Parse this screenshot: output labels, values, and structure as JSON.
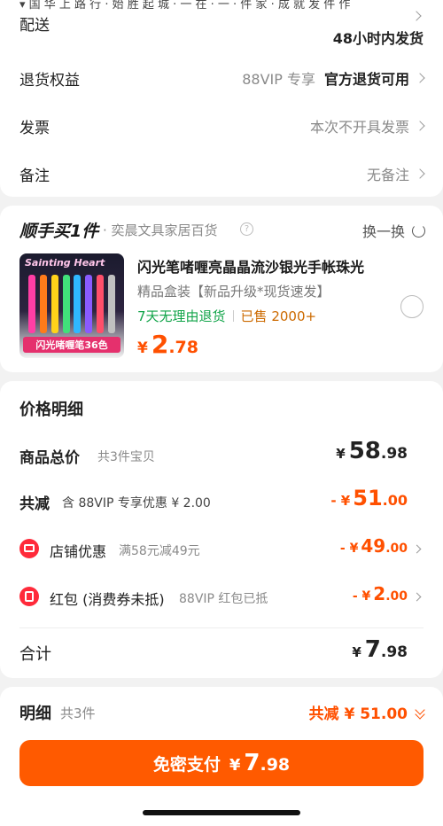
{
  "top_partial": "▾ 国 华 上 路 行 · 始 胜 起 城 · 一 在 · 一 · 件 家 · 成 就 发 件 作",
  "delivery": {
    "label": "配送",
    "value": "48小时内发货"
  },
  "refund": {
    "label": "退货权益",
    "badge": "88VIP 专享",
    "value": "官方退货可用"
  },
  "invoice": {
    "label": "发票",
    "value": "本次不开具发票"
  },
  "note": {
    "label": "备注",
    "value": "无备注"
  },
  "addon": {
    "logo": "顺手买1件",
    "store": "· 奕晨文具家居百货",
    "help_icon": "question-circle-icon",
    "swap": "换一换",
    "product": {
      "image_text_top": "Sainting Heart",
      "image_text_bottom": "闪光啫喱笔36色",
      "title": "闪光笔啫喱亮晶晶流沙银光手帐珠光",
      "subtitle": "精品盒装【新品升级*现货速发】",
      "return": "7天无理由退货",
      "sold": "已售 2000+",
      "price_int": "2",
      "price_dec": ".78",
      "currency": "¥"
    }
  },
  "price": {
    "header": "价格明细",
    "goods_total": {
      "label": "商品总价",
      "sub": "共3件宝贝",
      "currency": "¥",
      "int": "58",
      "dec": ".98"
    },
    "discount": {
      "label": "共减",
      "sub": "含 88VIP 专享优惠 ¥ 2.00",
      "prefix": "- ¥",
      "int": "51",
      "dec": ".00"
    },
    "shop": {
      "label": "店铺优惠",
      "sub": "满58元减49元",
      "prefix": "- ¥",
      "int": "49",
      "dec": ".00"
    },
    "redpacket": {
      "label": "红包 (消费券未抵)",
      "sub": "88VIP 红包已抵",
      "prefix": "- ¥",
      "int": "2",
      "dec": ".00"
    },
    "total": {
      "label": "合计",
      "currency": "¥",
      "int": "7",
      "dec": ".98"
    }
  },
  "bottom": {
    "label": "明细",
    "count": "共3件",
    "saving": "共减 ¥ 51.00",
    "pay_label": "免密支付",
    "pay_currency": "¥",
    "pay_int": "7",
    "pay_dec": ".98"
  },
  "colors": {
    "orange": "#ff5000",
    "green": "#11a449",
    "button": "#ff5a00"
  }
}
